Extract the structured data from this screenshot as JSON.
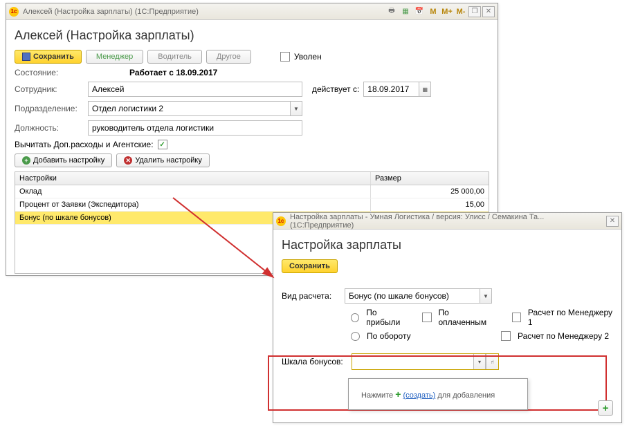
{
  "win1": {
    "title": "Алексей (Настройка зарплаты)  (1С:Предприятие)",
    "heading": "Алексей (Настройка зарплаты)",
    "save": "Сохранить",
    "tabs": {
      "manager": "Менеджер",
      "driver": "Водитель",
      "other": "Другое"
    },
    "fired_label": "Уволен",
    "state_label": "Состояние:",
    "state_value": "Работает   с    18.09.2017",
    "employee_label": "Сотрудник:",
    "employee_value": "Алексей",
    "valid_from_label": "действует с:",
    "valid_from_value": "18.09.2017",
    "dept_label": "Подразделение:",
    "dept_value": "Отдел логистики 2",
    "position_label": "Должность:",
    "position_value": "руководитель отдела логистики",
    "deduct_label": "Вычитать Доп.расходы и Агентские:",
    "btn_add": "Добавить настройку",
    "btn_del": "Удалить настройку",
    "table": {
      "col1": "Настройки",
      "col2": "Размер",
      "rows": [
        {
          "name": "Оклад",
          "value": "25 000,00"
        },
        {
          "name": "Процент от Заявки (Экспедитора)",
          "value": "15,00"
        },
        {
          "name": "Бонус (по шкале бонусов)",
          "value": ""
        }
      ]
    }
  },
  "win2": {
    "title": "Настройка зарплаты - Умная Логистика / версия: Улисс / Семакина Та...  (1С:Предприятие)",
    "heading": "Настройка зарплаты",
    "save": "Сохранить",
    "calc_label": "Вид расчета:",
    "calc_value": "Бонус (по шкале бонусов)",
    "radio_profit": "По прибыли",
    "radio_turnover": "По обороту",
    "chk_paid": "По оплаченным",
    "chk_mgr1": "Расчет по Менеджеру 1",
    "chk_mgr2": "Расчет по Менеджеру 2",
    "scale_label": "Шкала бонусов:",
    "dropdown_hint_prefix": "Нажмите ",
    "dropdown_hint_link": "(создать)",
    "dropdown_hint_suffix": " для добавления"
  }
}
